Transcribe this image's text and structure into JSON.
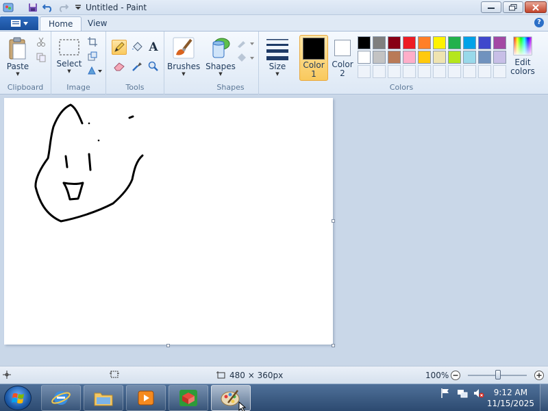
{
  "window": {
    "title": "Untitled - Paint"
  },
  "tabs": [
    {
      "label": "Home"
    },
    {
      "label": "View"
    }
  ],
  "ribbon": {
    "clipboard": {
      "paste": "Paste",
      "group": "Clipboard"
    },
    "image": {
      "select": "Select",
      "group": "Image"
    },
    "tools": {
      "group": "Tools",
      "text_tool": "A"
    },
    "brushes": {
      "label": "Brushes"
    },
    "shapes": {
      "label": "Shapes",
      "group": "Shapes"
    },
    "size": {
      "label": "Size"
    },
    "color1": {
      "line1": "Color",
      "line2": "1",
      "value": "#000000"
    },
    "color2": {
      "line1": "Color",
      "line2": "2",
      "value": "#ffffff"
    },
    "colors": {
      "group": "Colors",
      "row1": [
        "#000000",
        "#7f7f7f",
        "#880015",
        "#ed1c24",
        "#ff7f27",
        "#fff200",
        "#22b14c",
        "#00a2e8",
        "#3f48cc",
        "#a349a4"
      ],
      "row2": [
        "#ffffff",
        "#c3c3c3",
        "#b97a57",
        "#ffaec9",
        "#ffc90e",
        "#efe4b0",
        "#b5e61d",
        "#99d9ea",
        "#7092be",
        "#c8bfe7"
      ]
    },
    "edit_colors": {
      "line1": "Edit",
      "line2": "colors"
    }
  },
  "statusbar": {
    "dimensions": "480 × 360px",
    "zoom": "100%",
    "zoom_level": 100
  },
  "taskbar": {
    "time": "9:12 AM",
    "date": "11/15/2025"
  }
}
